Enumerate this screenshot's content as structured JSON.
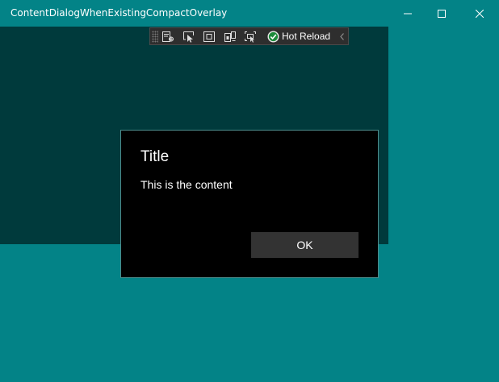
{
  "window": {
    "title": "ContentDialogWhenExistingCompactOverlay",
    "minimize_icon": "minimize-icon",
    "maximize_icon": "maximize-icon",
    "close_icon": "close-icon",
    "background_color": "#038387",
    "overlay_color": "#003a3c"
  },
  "hot_reload_toolbar": {
    "tools": [
      {
        "icon": "live-visual-tree-icon"
      },
      {
        "icon": "select-element-icon"
      },
      {
        "icon": "display-layout-adorners-icon"
      },
      {
        "icon": "track-focus-icon"
      },
      {
        "icon": "binding-failures-icon"
      }
    ],
    "status_icon": "check-circle-icon",
    "label": "Hot Reload",
    "collapse_icon": "chevron-left-icon"
  },
  "dialog": {
    "title": "Title",
    "content": "This is the content",
    "primary_button": "OK",
    "background_color": "#000000"
  }
}
